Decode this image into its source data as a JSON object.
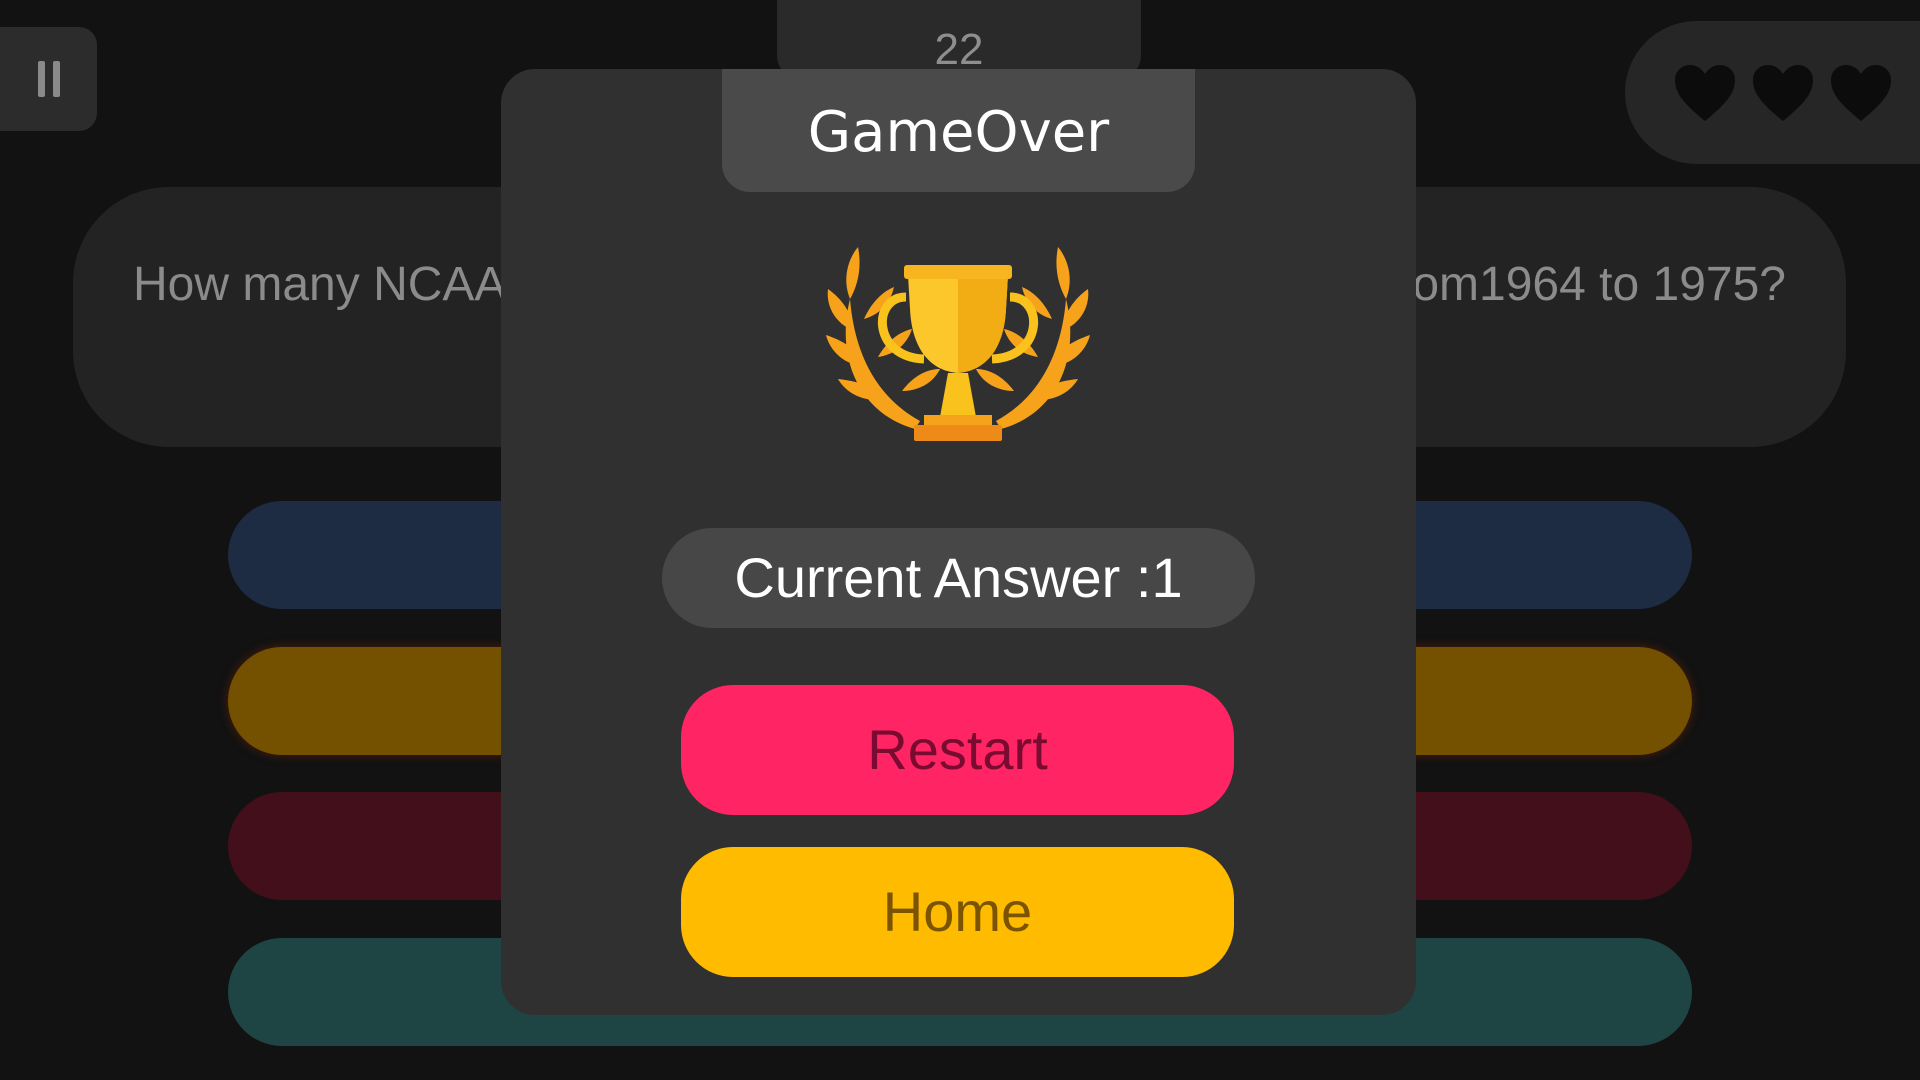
{
  "hud": {
    "timer": "22",
    "lives": 3
  },
  "question": {
    "text_left": "How many NCAA n",
    "text_right": "from1964 to 1975?"
  },
  "modal": {
    "title": "GameOver",
    "trophy_icon": "trophy-icon",
    "score_label": "Current Answer :1",
    "restart_label": "Restart",
    "home_label": "Home"
  },
  "colors": {
    "restart": "#ff2463",
    "home": "#ffbb00",
    "answer_blue": "#1d2b43",
    "answer_yellow": "#745100",
    "answer_red": "#430f1a",
    "answer_teal": "#1e4444",
    "heart": "#0c0c0c"
  }
}
